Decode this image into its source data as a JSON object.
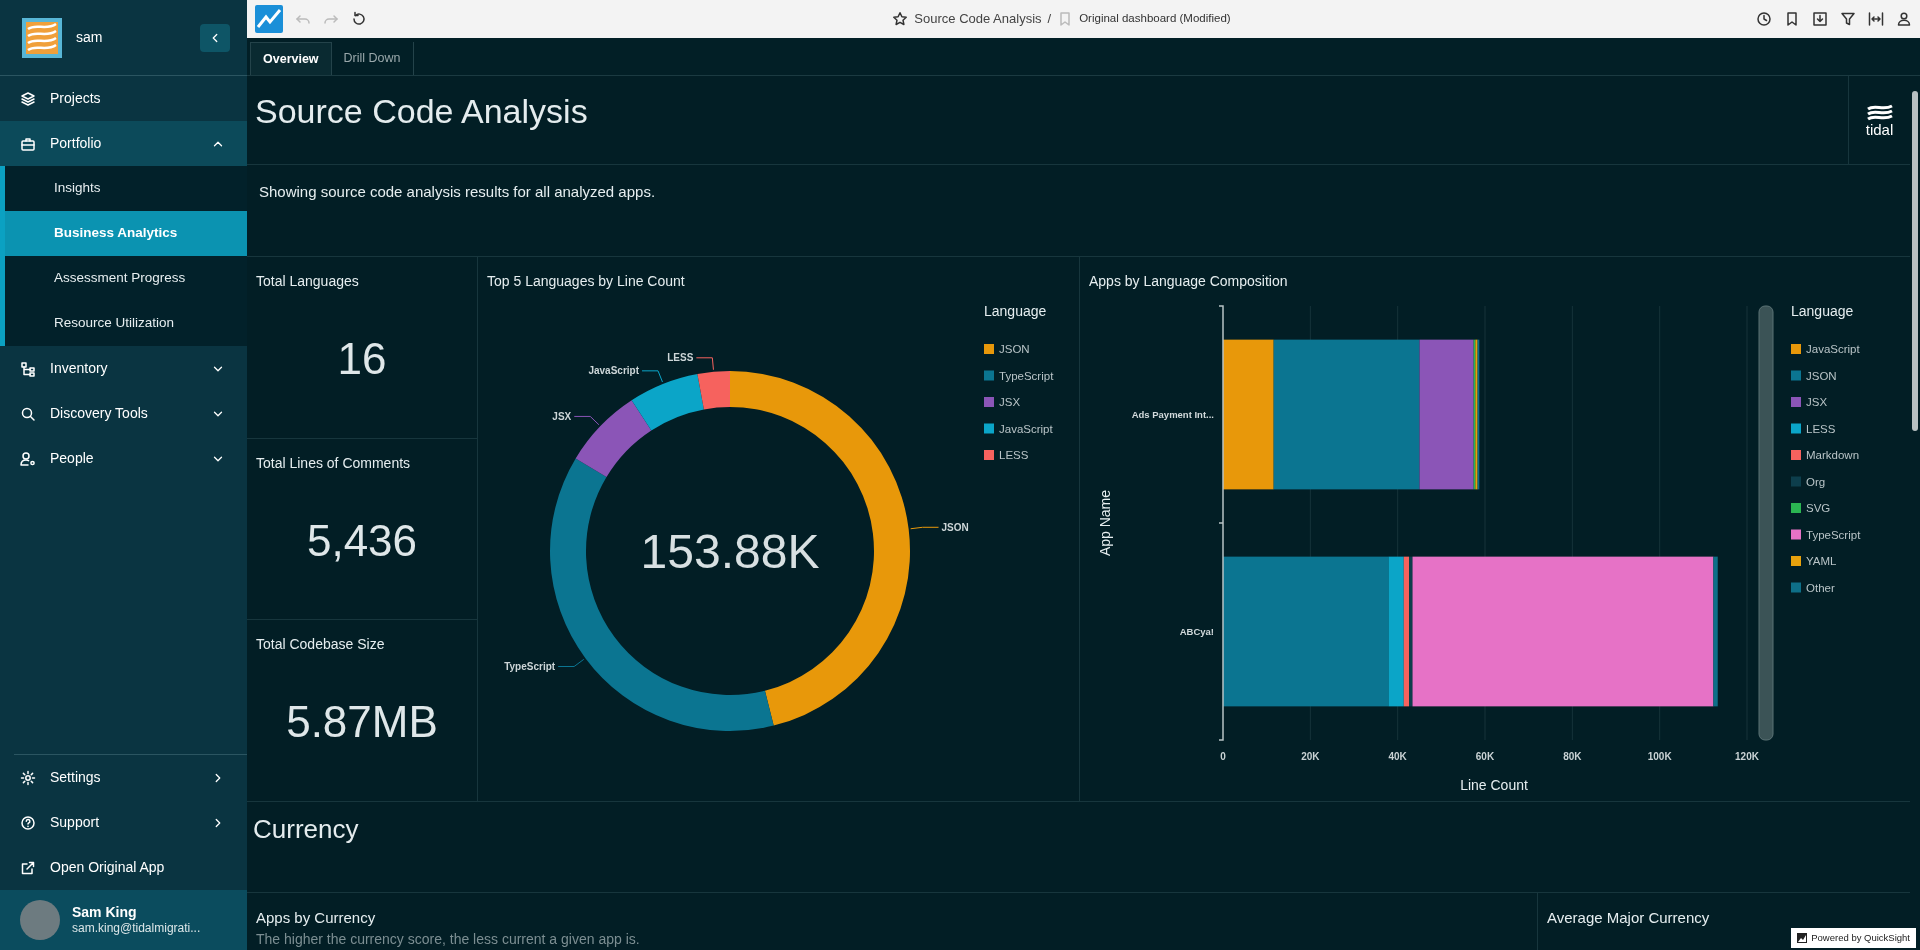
{
  "sidebar": {
    "org": "sam",
    "items": [
      {
        "label": "Projects",
        "selected": false
      },
      {
        "label": "Portfolio",
        "selected": false,
        "expanded": true,
        "children": [
          {
            "label": "Insights",
            "selected": false
          },
          {
            "label": "Business Analytics",
            "selected": true
          },
          {
            "label": "Assessment Progress",
            "selected": false
          },
          {
            "label": "Resource Utilization",
            "selected": false
          }
        ]
      },
      {
        "label": "Inventory",
        "selected": false,
        "expanded": false
      },
      {
        "label": "Discovery Tools",
        "selected": false,
        "expanded": false
      },
      {
        "label": "People",
        "selected": false,
        "expanded": false
      }
    ],
    "bottom_items": [
      {
        "label": "Settings",
        "kind": "submenu"
      },
      {
        "label": "Support",
        "kind": "submenu"
      },
      {
        "label": "Open Original App",
        "kind": "link"
      }
    ],
    "user": {
      "name": "Sam King",
      "email": "sam.king@tidalmigrati..."
    }
  },
  "toolbar": {
    "undo": {
      "disabled": true
    },
    "redo": {
      "disabled": true
    },
    "title": "Source Code Analysis",
    "separator": "/",
    "subtitle": "Original dashboard (Modified)"
  },
  "tabs": [
    {
      "label": "Overview",
      "selected": true
    },
    {
      "label": "Drill Down",
      "selected": false
    }
  ],
  "sheet": {
    "title": "Source Code Analysis",
    "logo_text": "tidal",
    "description": "Showing source code analysis results for all analyzed apps.",
    "kpis": [
      {
        "title": "Total Languages",
        "value": "16"
      },
      {
        "title": "Total Lines of Comments",
        "value": "5,436"
      },
      {
        "title": "Total Codebase Size",
        "value": "5.87MB"
      }
    ],
    "donut": {
      "center_value": "153.88K",
      "legend_title": "Language",
      "legend": [
        {
          "label": "JSON",
          "color": "#e8980a"
        },
        {
          "label": "TypeScript",
          "color": "#0b7591"
        },
        {
          "label": "JSX",
          "color": "#8b55b7"
        },
        {
          "label": "JavaScript",
          "color": "#0ba5c8"
        },
        {
          "label": "LESS",
          "color": "#f6625e"
        }
      ],
      "chart_data": {
        "type": "donut",
        "title": "Top 5 Languages by Line Count",
        "categories": [
          "JSON",
          "TypeScript",
          "JSX",
          "JavaScript",
          "LESS"
        ],
        "values": [
          46.1,
          37.5,
          7.2,
          6.3,
          2.9
        ]
      }
    },
    "bars": {
      "chart_data": {
        "type": "bar",
        "title": "Apps by Language Composition",
        "orientation": "horizontal",
        "stacked": true,
        "xlabel": "Line Count",
        "ylabel": "App Name",
        "categories": [
          "Ads Payment Int...",
          "ABCya!"
        ],
        "series": [
          {
            "name": "JavaScript",
            "color": "#e8980a",
            "values": [
              11600,
              0
            ]
          },
          {
            "name": "JSON",
            "color": "#0b7591",
            "values": [
              33400,
              37900
            ]
          },
          {
            "name": "JSX",
            "color": "#8b55b7",
            "values": [
              12400,
              0
            ]
          },
          {
            "name": "LESS",
            "color": "#0ba5c8",
            "values": [
              0,
              3500
            ]
          },
          {
            "name": "Markdown",
            "color": "#f6625e",
            "values": [
              0,
              1200
            ]
          },
          {
            "name": "Org",
            "color": "#0d3e4c",
            "values": [
              0,
              800
            ]
          },
          {
            "name": "SVG",
            "color": "#2bb552",
            "values": [
              400,
              0
            ]
          },
          {
            "name": "TypeScript",
            "color": "#e672c6",
            "values": [
              0,
              68900
            ]
          },
          {
            "name": "YAML",
            "color": "#e8a20d",
            "values": [
              500,
              0
            ]
          },
          {
            "name": "Other",
            "color": "#0e6f88",
            "values": [
              400,
              1000
            ]
          }
        ],
        "xlim": [
          0,
          120000
        ],
        "grid": true,
        "legend": {
          "title": "Language"
        },
        "xticks": [
          {
            "value": 0,
            "label": "0"
          },
          {
            "value": 20000,
            "label": "20K"
          },
          {
            "value": 40000,
            "label": "40K"
          },
          {
            "value": 60000,
            "label": "60K"
          },
          {
            "value": 80000,
            "label": "80K"
          },
          {
            "value": 100000,
            "label": "100K"
          },
          {
            "value": 120000,
            "label": "120K"
          }
        ]
      }
    },
    "section_title": "Currency",
    "cards": [
      {
        "title": "Apps by Currency",
        "text": "The higher the currency score, the less current a given app is."
      },
      {
        "title": "Average Major Currency"
      }
    ]
  },
  "badge": "Powered by QuickSight"
}
